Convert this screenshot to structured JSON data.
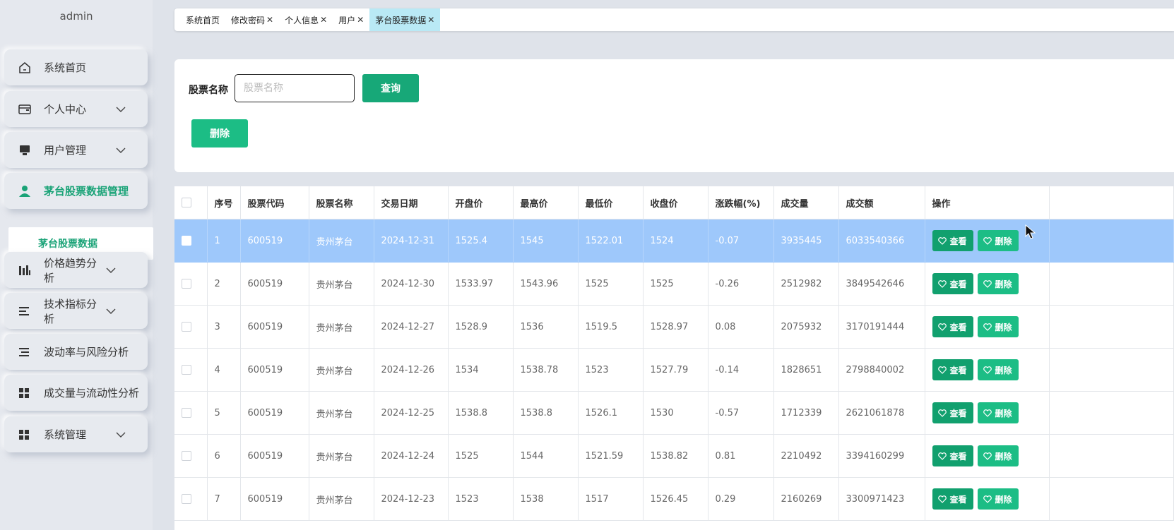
{
  "user": {
    "name": "admin"
  },
  "sidebar": {
    "items": [
      {
        "label": "系统首页",
        "icon": "home-icon",
        "expandable": false
      },
      {
        "label": "个人中心",
        "icon": "wallet-icon",
        "expandable": true
      },
      {
        "label": "用户管理",
        "icon": "monitor-icon",
        "expandable": true
      },
      {
        "label": "茅台股票数据管理",
        "icon": "person-icon",
        "expandable": false,
        "active": true
      },
      {
        "label": "价格趋势分析",
        "icon": "bar-chart-icon",
        "expandable": true
      },
      {
        "label": "技术指标分析",
        "icon": "list-icon",
        "expandable": true
      },
      {
        "label": "波动率与风险分析",
        "icon": "list-indent-icon",
        "expandable": false
      },
      {
        "label": "成交量与流动性分析",
        "icon": "grid-icon",
        "expandable": false
      },
      {
        "label": "系统管理",
        "icon": "grid-icon",
        "expandable": true
      }
    ],
    "subitem": {
      "label": "茅台股票数据"
    }
  },
  "tabs": [
    {
      "label": "系统首页",
      "closable": false
    },
    {
      "label": "修改密码",
      "closable": true
    },
    {
      "label": "个人信息",
      "closable": true
    },
    {
      "label": "用户",
      "closable": true
    },
    {
      "label": "茅台股票数据",
      "closable": true,
      "active": true
    }
  ],
  "search": {
    "label": "股票名称",
    "placeholder": "股票名称",
    "value": "",
    "query_label": "查询",
    "delete_label": "删除"
  },
  "table": {
    "columns": [
      "序号",
      "股票代码",
      "股票名称",
      "交易日期",
      "开盘价",
      "最高价",
      "最低价",
      "收盘价",
      "涨跌幅(%)",
      "成交量",
      "成交额",
      "操作"
    ],
    "view_label": "查看",
    "delete_label": "删除",
    "rows": [
      [
        "1",
        "600519",
        "贵州茅台",
        "2024-12-31",
        "1525.4",
        "1545",
        "1522.01",
        "1524",
        "-0.07",
        "3935445",
        "6033540366"
      ],
      [
        "2",
        "600519",
        "贵州茅台",
        "2024-12-30",
        "1533.97",
        "1543.96",
        "1525",
        "1525",
        "-0.26",
        "2512982",
        "3849542646"
      ],
      [
        "3",
        "600519",
        "贵州茅台",
        "2024-12-27",
        "1528.9",
        "1536",
        "1519.5",
        "1528.97",
        "0.08",
        "2075932",
        "3170191444"
      ],
      [
        "4",
        "600519",
        "贵州茅台",
        "2024-12-26",
        "1534",
        "1538.78",
        "1523",
        "1527.79",
        "-0.14",
        "1828651",
        "2798840002"
      ],
      [
        "5",
        "600519",
        "贵州茅台",
        "2024-12-25",
        "1538.8",
        "1538.8",
        "1526.1",
        "1530",
        "-0.57",
        "1712339",
        "2621061878"
      ],
      [
        "6",
        "600519",
        "贵州茅台",
        "2024-12-24",
        "1525",
        "1544",
        "1521.59",
        "1538.82",
        "0.81",
        "2210492",
        "3394160299"
      ],
      [
        "7",
        "600519",
        "贵州茅台",
        "2024-12-23",
        "1523",
        "1538",
        "1517",
        "1526.45",
        "0.29",
        "2160269",
        "3300971423"
      ]
    ],
    "selected_row": 0
  },
  "colors": {
    "accent": "#17a878",
    "accent_light": "#1cbd85",
    "selected_row": "#9ec8fb",
    "active_tab": "#b9e9f5"
  }
}
